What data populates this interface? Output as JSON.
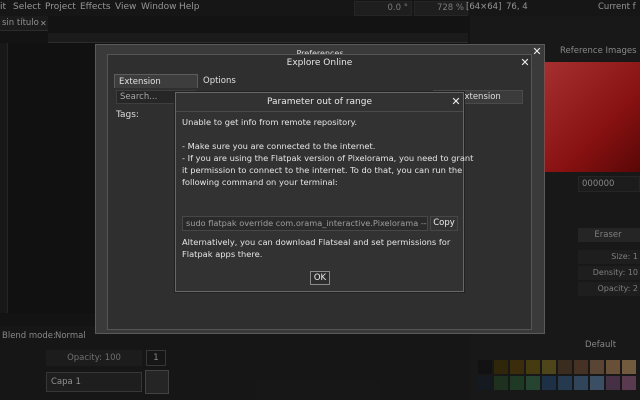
{
  "menubar": {
    "items": [
      "it",
      "Select",
      "Project",
      "Effects",
      "View",
      "Window",
      "Help"
    ],
    "rotation": "0.0 °",
    "zoom": "728 %",
    "canvas_size": "[64×64]",
    "cursor_pos": "76, 4",
    "current_label": "Current f"
  },
  "tab": {
    "title": "sin título",
    "close": "✕"
  },
  "right_panel": {
    "reference_images": "Reference Images",
    "hex": "000000",
    "tool_name": "Eraser",
    "size": "Size: 1",
    "density": "Density: 10",
    "opacity": "Opacity: 2",
    "palette_default": "Default"
  },
  "layers": {
    "blend_mode_label": "Blend mode:",
    "blend_mode_value": "Normal",
    "opacity": "Opacity: 100",
    "frame": "1",
    "layer_name": "Capa 1"
  },
  "preferences": {
    "title": "Preferences"
  },
  "explore": {
    "title": "Explore Online",
    "tabs": [
      "Extension Explorer",
      "Options"
    ],
    "search_placeholder": "Search...",
    "tags_label": "Tags:",
    "submit_button": "n an extension"
  },
  "error_dialog": {
    "title": "Parameter out of range",
    "lines": [
      "Unable to get info from remote repository.",
      "- Make sure you are connected to the internet.",
      "- If you are using the Flatpak version of Pixelorama, you need to grant",
      "it permission to connect to the internet. To do that, you can run the",
      "following command on your terminal:",
      "Alternatively, you can download Flatseal and set permissions for",
      "Flatpak apps there."
    ],
    "command": "sudo flatpak override com.orama_interactive.Pixelorama --sh",
    "copy_label": "Copy",
    "ok_label": "OK"
  },
  "palette_colors": [
    "#1d1d1d",
    "#4a3b10",
    "#5b4612",
    "#6b5a1a",
    "#7a6a2a",
    "#5a4630",
    "#6b4d3a",
    "#8a6a50",
    "#a07a55",
    "#b08a60",
    "#202830",
    "#2e4a2e",
    "#2f5a3a",
    "#3a6a4a",
    "#2e4a6a",
    "#3a5a7a",
    "#4a6a8a",
    "#5a7a9a",
    "#6a4a6a",
    "#8a5a7a"
  ]
}
